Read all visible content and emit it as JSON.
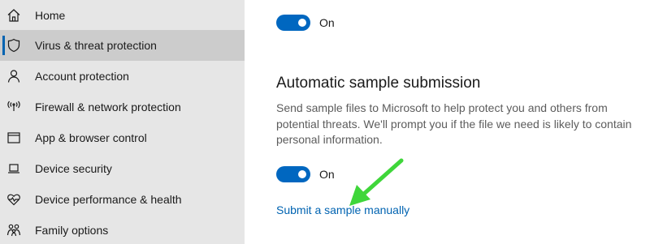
{
  "sidebar": {
    "items": [
      {
        "label": "Home",
        "icon": "home-icon"
      },
      {
        "label": "Virus & threat protection",
        "icon": "shield-icon",
        "selected": true
      },
      {
        "label": "Account protection",
        "icon": "person-icon"
      },
      {
        "label": "Firewall & network protection",
        "icon": "wifi-signal-icon"
      },
      {
        "label": "App & browser control",
        "icon": "browser-window-icon"
      },
      {
        "label": "Device security",
        "icon": "laptop-icon"
      },
      {
        "label": "Device performance & health",
        "icon": "heart-pulse-icon"
      },
      {
        "label": "Family options",
        "icon": "family-icon"
      }
    ]
  },
  "main": {
    "top_toggle": {
      "state_label": "On",
      "on": true
    },
    "sample_submission": {
      "title": "Automatic sample submission",
      "description": "Send sample files to Microsoft to help protect you and others from potential threats. We'll prompt you if the file we need is likely to contain personal information.",
      "toggle": {
        "state_label": "On",
        "on": true
      },
      "link": "Submit a sample manually"
    }
  },
  "colors": {
    "sidebar_bg": "#e6e6e6",
    "selected_bg": "#cccccc",
    "accent": "#0063b1",
    "toggle_on": "#0067c0",
    "annotation_arrow": "#3fd63a"
  }
}
